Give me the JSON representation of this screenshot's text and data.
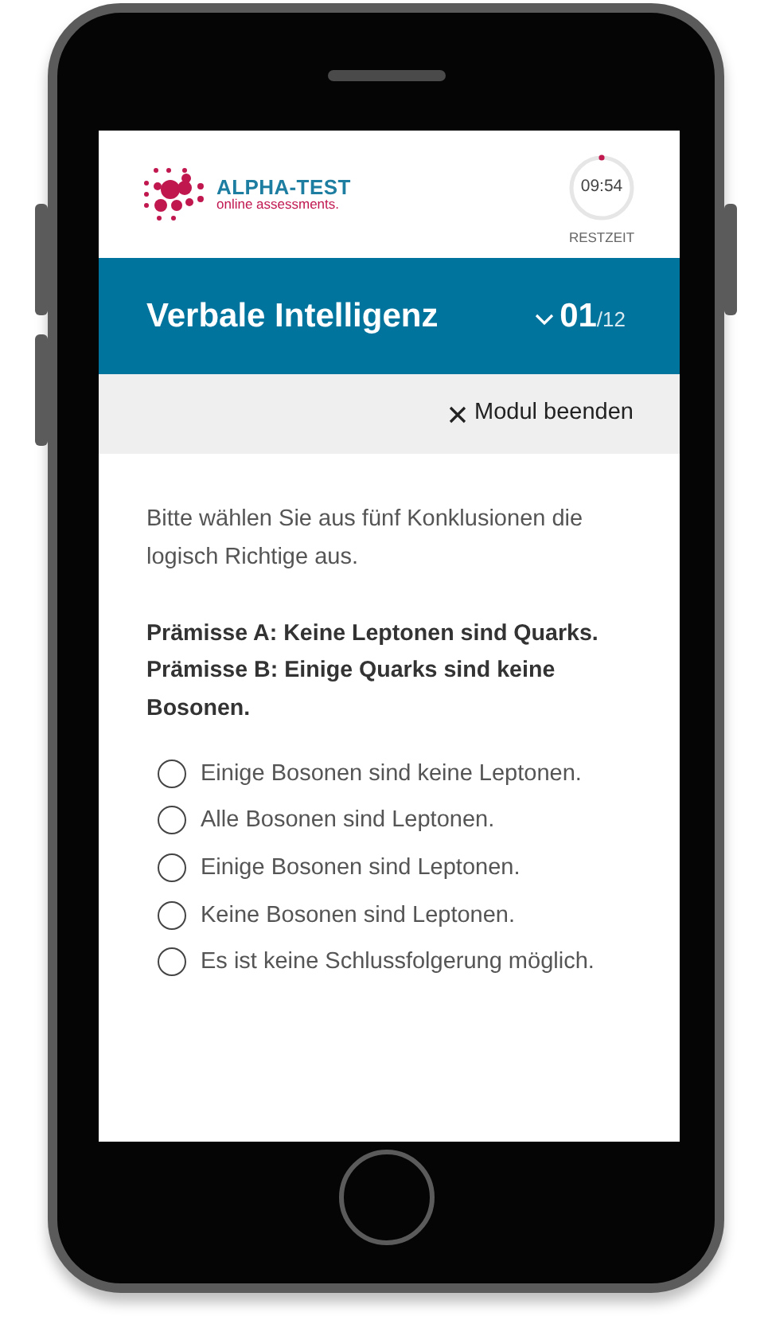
{
  "logo": {
    "name": "ALPHA-TEST",
    "tagline": "online assessments."
  },
  "timer": {
    "time": "09:54",
    "label": "RESTZEIT"
  },
  "module": {
    "title": "Verbale Intelligenz",
    "current": "01",
    "total": "/12"
  },
  "end_button": {
    "label": "Modul beenden"
  },
  "question": {
    "instruction": "Bitte wählen Sie aus fünf Konklusionen die logisch Richtige aus.",
    "premises": [
      "Prämisse A: Keine Leptonen sind Quarks.",
      "Prämisse B: Einige Quarks sind keine Bosonen."
    ]
  },
  "options": [
    {
      "label": "Einige Bosonen sind keine Leptonen.",
      "selected": false
    },
    {
      "label": "Alle Bosonen sind Leptonen.",
      "selected": false
    },
    {
      "label": "Einige Bosonen sind Leptonen.",
      "selected": false
    },
    {
      "label": "Keine Bosonen sind Leptonen.",
      "selected": false
    },
    {
      "label": "Es ist keine Schlussfolgerung möglich.",
      "selected": false
    }
  ]
}
